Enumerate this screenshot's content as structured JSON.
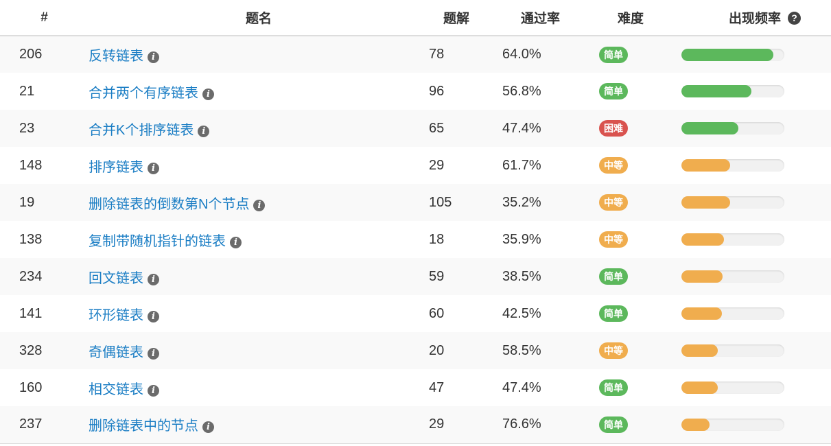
{
  "colors": {
    "link": "#1a7dc4",
    "easy": "#5cb85c",
    "medium": "#f0ad4e",
    "hard": "#d9534f",
    "bar_green": "#5cb85c",
    "bar_orange": "#f0ad4e"
  },
  "header": {
    "id": "#",
    "title": "题名",
    "solutions": "题解",
    "acceptance": "通过率",
    "difficulty": "难度",
    "frequency": "出现频率",
    "help_icon": "question-circle-icon"
  },
  "rows": [
    {
      "id": "206",
      "title": "反转链表",
      "solutions": "78",
      "acceptance": "64.0%",
      "difficulty": "简单",
      "level": "easy",
      "frequency": 0.89,
      "bar": "green"
    },
    {
      "id": "21",
      "title": "合并两个有序链表",
      "solutions": "96",
      "acceptance": "56.8%",
      "difficulty": "简单",
      "level": "easy",
      "frequency": 0.68,
      "bar": "green"
    },
    {
      "id": "23",
      "title": "合并K个排序链表",
      "solutions": "65",
      "acceptance": "47.4%",
      "difficulty": "困难",
      "level": "hard",
      "frequency": 0.55,
      "bar": "green"
    },
    {
      "id": "148",
      "title": "排序链表",
      "solutions": "29",
      "acceptance": "61.7%",
      "difficulty": "中等",
      "level": "medium",
      "frequency": 0.47,
      "bar": "orange"
    },
    {
      "id": "19",
      "title": "删除链表的倒数第N个节点",
      "solutions": "105",
      "acceptance": "35.2%",
      "difficulty": "中等",
      "level": "medium",
      "frequency": 0.47,
      "bar": "orange"
    },
    {
      "id": "138",
      "title": "复制带随机指针的链表",
      "solutions": "18",
      "acceptance": "35.9%",
      "difficulty": "中等",
      "level": "medium",
      "frequency": 0.41,
      "bar": "orange"
    },
    {
      "id": "234",
      "title": "回文链表",
      "solutions": "59",
      "acceptance": "38.5%",
      "difficulty": "简单",
      "level": "easy",
      "frequency": 0.4,
      "bar": "orange"
    },
    {
      "id": "141",
      "title": "环形链表",
      "solutions": "60",
      "acceptance": "42.5%",
      "difficulty": "简单",
      "level": "easy",
      "frequency": 0.39,
      "bar": "orange"
    },
    {
      "id": "328",
      "title": "奇偶链表",
      "solutions": "20",
      "acceptance": "58.5%",
      "difficulty": "中等",
      "level": "medium",
      "frequency": 0.35,
      "bar": "orange"
    },
    {
      "id": "160",
      "title": "相交链表",
      "solutions": "47",
      "acceptance": "47.4%",
      "difficulty": "简单",
      "level": "easy",
      "frequency": 0.35,
      "bar": "orange"
    },
    {
      "id": "237",
      "title": "删除链表中的节点",
      "solutions": "29",
      "acceptance": "76.6%",
      "difficulty": "简单",
      "level": "easy",
      "frequency": 0.27,
      "bar": "orange"
    }
  ]
}
